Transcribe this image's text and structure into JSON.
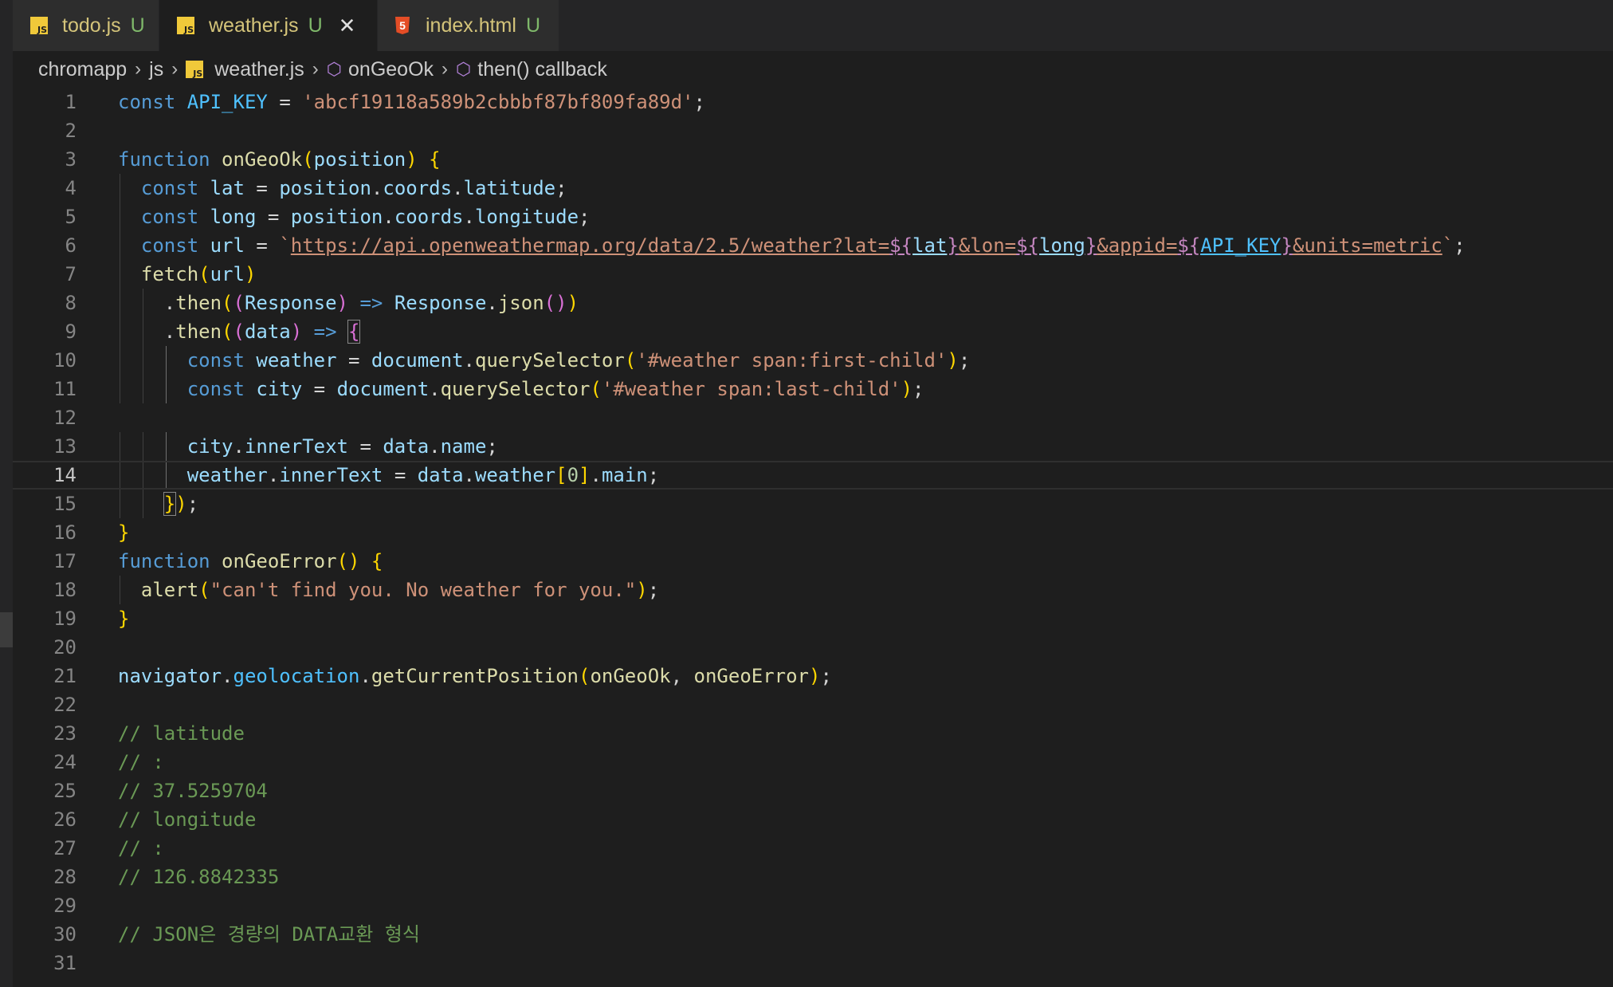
{
  "tabs": [
    {
      "name": "todo.js",
      "status": "U",
      "type": "js"
    },
    {
      "name": "weather.js",
      "status": "U",
      "type": "js",
      "active": true
    },
    {
      "name": "index.html",
      "status": "U",
      "type": "html"
    }
  ],
  "breadcrumb": {
    "folder1": "chromapp",
    "folder2": "js",
    "file": "weather.js",
    "symbol1": "onGeoOk",
    "symbol2": "then() callback"
  },
  "icons": {
    "js": "JS",
    "html": "5",
    "cube": "⬡",
    "chevron": "›",
    "close": "✕"
  },
  "editor": {
    "active_line": 14,
    "line_numbers": [
      "1",
      "2",
      "3",
      "4",
      "5",
      "6",
      "7",
      "8",
      "9",
      "10",
      "11",
      "12",
      "13",
      "14",
      "15",
      "16",
      "17",
      "18",
      "19",
      "20",
      "21",
      "22",
      "23",
      "24",
      "25",
      "26",
      "27",
      "28",
      "29",
      "30",
      "31"
    ],
    "lines": [
      "const API_KEY = 'abcf19118a589b2cbbbf87bf809fa89d';",
      "",
      "function onGeoOk(position) {",
      "  const lat = position.coords.latitude;",
      "  const long = position.coords.longitude;",
      "  const url = `https://api.openweathermap.org/data/2.5/weather?lat=${lat}&lon=${long}&appid=${API_KEY}&units=metric`;",
      "  fetch(url)",
      "    .then((Response) => Response.json())",
      "    .then((data) => {",
      "      const weather = document.querySelector('#weather span:first-child');",
      "      const city = document.querySelector('#weather span:last-child');",
      "",
      "      city.innerText = data.name;",
      "      weather.innerText = data.weather[0].main;",
      "    });",
      "}",
      "function onGeoError() {",
      "  alert(\"can't find you. No weather for you.\");",
      "}",
      "",
      "navigator.geolocation.getCurrentPosition(onGeoOk, onGeoError);",
      "",
      "// latitude",
      "// :",
      "// 37.5259704",
      "// longitude",
      "// :",
      "// 126.8842335",
      "",
      "// JSON은 경량의 DATA교환 형식",
      ""
    ]
  }
}
